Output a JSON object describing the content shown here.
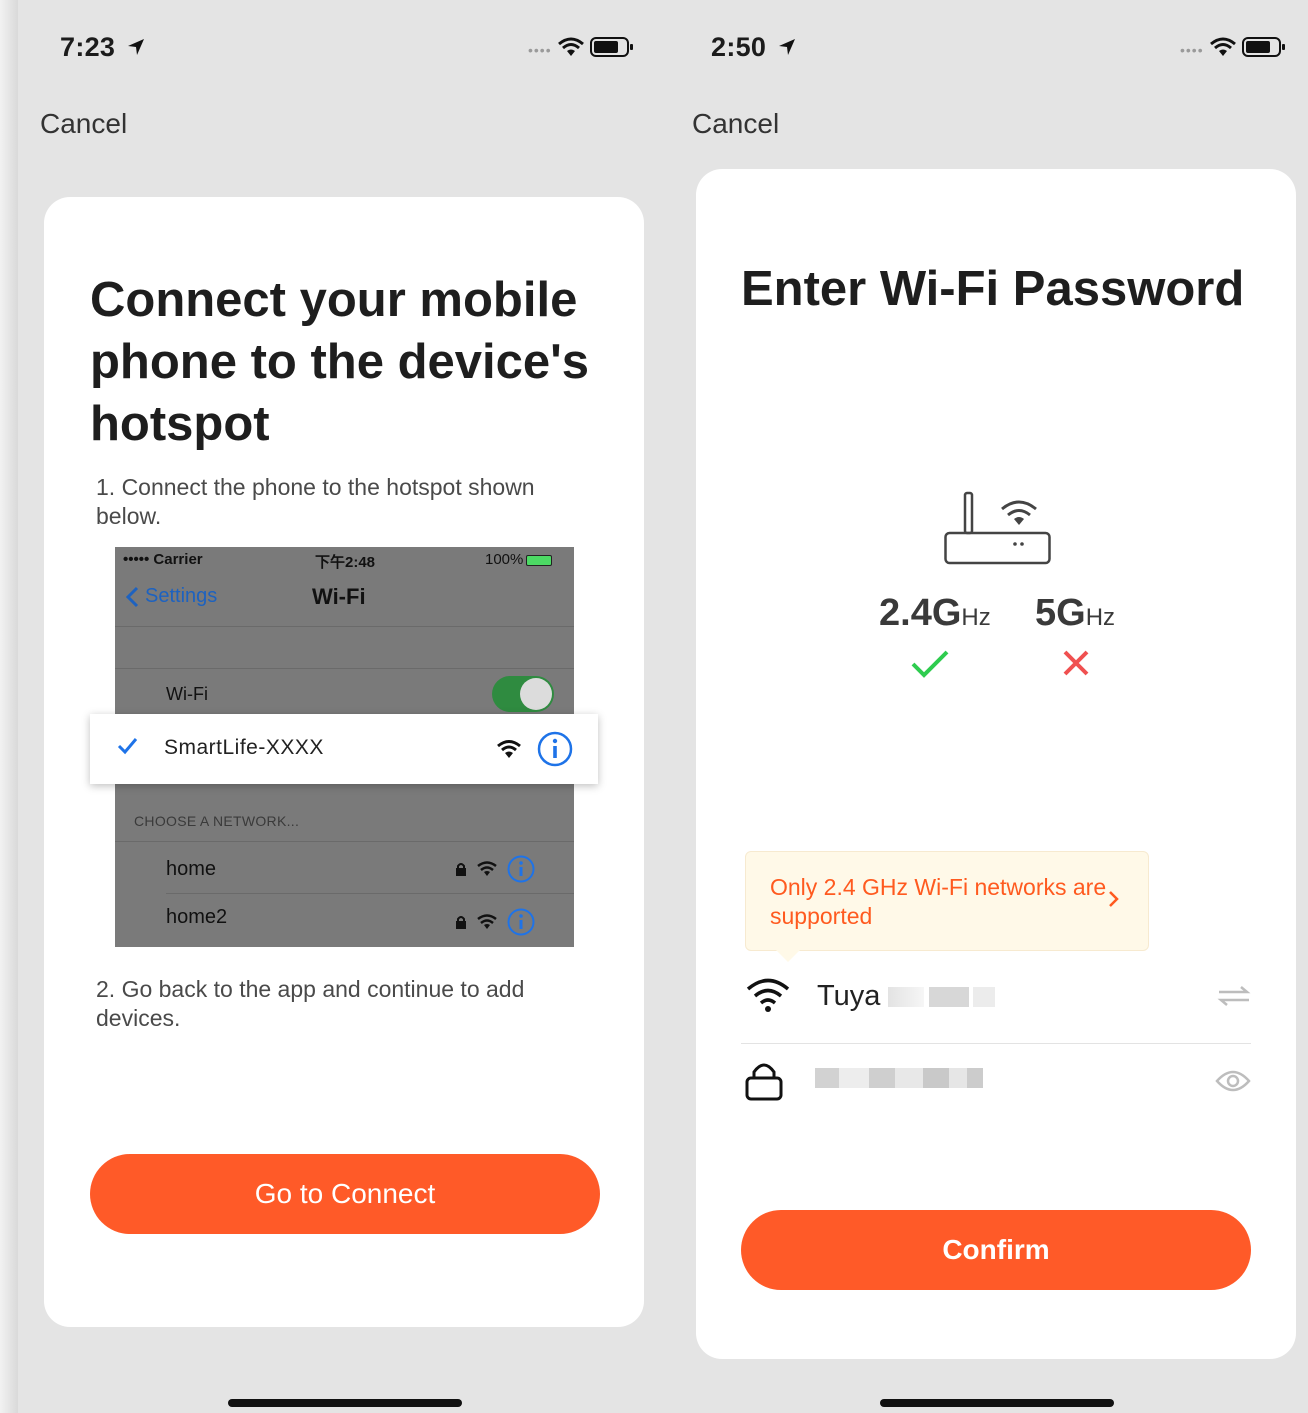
{
  "left_screen": {
    "status": {
      "time": "7:23"
    },
    "cancel_label": "Cancel",
    "title": "Connect your mobile phone to the device's hotspot",
    "step1": "1. Connect the phone to the hotspot shown below.",
    "example": {
      "carrier": "••••• Carrier",
      "time": "下午2:48",
      "battery": "100%",
      "back_label": "Settings",
      "nav_title": "Wi-Fi",
      "wifi_label": "Wi-Fi",
      "hotspot_ssid": "SmartLife-XXXX",
      "choose_label": "CHOOSE A NETWORK...",
      "networks": [
        "home",
        "home2"
      ]
    },
    "step2": "2. Go back to the app and continue to add devices.",
    "connect_button": "Go to Connect"
  },
  "right_screen": {
    "status": {
      "time": "2:50"
    },
    "cancel_label": "Cancel",
    "title": "Enter Wi-Fi Password",
    "bands": [
      {
        "value": "2.4G",
        "unit": "Hz",
        "supported": true,
        "mark_color": "#2ecc4f"
      },
      {
        "value": "5G",
        "unit": "Hz",
        "supported": false,
        "mark_color": "#f05050"
      }
    ],
    "tip": "Only 2.4 GHz Wi-Fi networks are supported",
    "ssid_visible": "Tuya",
    "confirm_button": "Confirm"
  },
  "colors": {
    "accent": "#ff5a28",
    "tip_text": "#ff5a1f",
    "tip_background": "#fff9e8"
  }
}
